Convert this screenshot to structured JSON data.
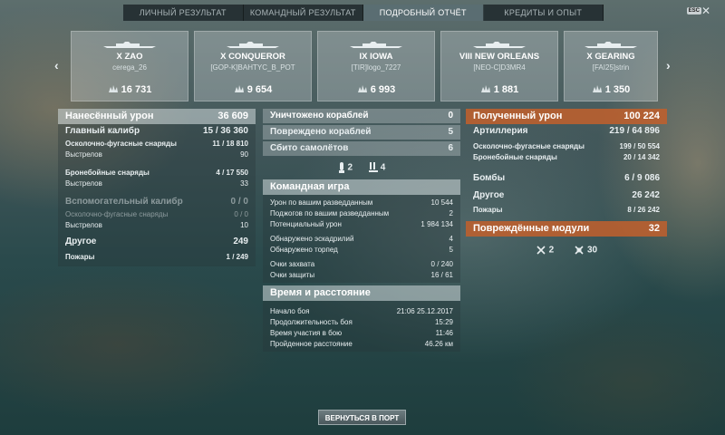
{
  "tabs": [
    "ЛИЧНЫЙ РЕЗУЛЬТАТ",
    "КОМАНДНЫЙ РЕЗУЛЬТАТ",
    "ПОДРОБНЫЙ ОТЧЁТ",
    "КРЕДИТЫ И ОПЫТ"
  ],
  "active_tab": 2,
  "esc_label": "ESC",
  "close_glyph": "✕",
  "nav": {
    "left": "‹",
    "right": "›"
  },
  "ships": [
    {
      "name": "X ZAO",
      "player": "cerega_26",
      "damage": "16 731"
    },
    {
      "name": "X CONQUEROR",
      "player": "[GOP-K]BAHTYC_B_POT",
      "damage": "9 654"
    },
    {
      "name": "IX IOWA",
      "player": "[TIR]logo_7227",
      "damage": "6 993"
    },
    {
      "name": "VIII NEW ORLEANS",
      "player": "[NEO-C]D3MR4",
      "damage": "1 881"
    },
    {
      "name": "X GEARING",
      "player": "[FAI25]strin",
      "damage": "1 350"
    }
  ],
  "left": {
    "header": {
      "label": "Нанесённый урон",
      "value": "36 609"
    },
    "main_caliber": {
      "label": "Главный калибр",
      "value": "15 / 36 360"
    },
    "he": {
      "label": "Осколочно-фугасные снаряды",
      "value": "11 / 18 810"
    },
    "he_shots": {
      "label": "Выстрелов",
      "value": "90"
    },
    "ap": {
      "label": "Бронебойные снаряды",
      "value": "4 / 17 550"
    },
    "ap_shots": {
      "label": "Выстрелов",
      "value": "33"
    },
    "secondary": {
      "label": "Вспомогательный калибр",
      "value": "0 / 0"
    },
    "sec_he": {
      "label": "Осколочно-фугасные снаряды",
      "value": "0 / 0"
    },
    "sec_shots": {
      "label": "Выстрелов",
      "value": "10"
    },
    "other": {
      "label": "Другое",
      "value": "249"
    },
    "fires": {
      "label": "Пожары",
      "value": "1 / 249"
    }
  },
  "middle": {
    "destroyed": {
      "label": "Уничтожено кораблей",
      "value": "0"
    },
    "damaged": {
      "label": "Повреждено кораблей",
      "value": "5"
    },
    "planes": {
      "label": "Сбито самолётов",
      "value": "6"
    },
    "icon_counts": {
      "torpedo_hits": "2",
      "flood": "4"
    },
    "team_header": "Командная игра",
    "team_rows": [
      {
        "label": "Урон по вашим разведданным",
        "value": "10 544"
      },
      {
        "label": "Поджогов по вашим разведданным",
        "value": "2"
      },
      {
        "label": "Потенциальный урон",
        "value": "1 984 134"
      },
      {
        "label": "Обнаружено эскадрилий",
        "value": "4"
      },
      {
        "label": "Обнаружено торпед",
        "value": "5"
      },
      {
        "label": "Очки захвата",
        "value": "0 / 240"
      },
      {
        "label": "Очки защиты",
        "value": "16 / 61"
      }
    ],
    "time_header": "Время и расстояние",
    "time_rows": [
      {
        "label": "Начало боя",
        "value": "21:06  25.12.2017"
      },
      {
        "label": "Продолжительность боя",
        "value": "15:29"
      },
      {
        "label": "Время участия в бою",
        "value": "11:46"
      },
      {
        "label": "Пройденное расстояние",
        "value": "46.26 км"
      }
    ]
  },
  "right": {
    "header": {
      "label": "Полученный урон",
      "value": "100 224"
    },
    "artillery": {
      "label": "Артиллерия",
      "value_a": "219 / ",
      "value_b": "64 896"
    },
    "he": {
      "label": "Осколочно-фугасные снаряды",
      "value_a": "199 / ",
      "value_b": "50 554"
    },
    "ap": {
      "label": "Бронебойные снаряды",
      "value_a": "20 / ",
      "value_b": "14 342"
    },
    "bombs": {
      "label": "Бомбы",
      "value": "6 / 9 086"
    },
    "other": {
      "label": "Другое",
      "value": "26 242"
    },
    "fires": {
      "label": "Пожары",
      "value_a": "8 / ",
      "value_b": "26 242"
    },
    "modules": {
      "label": "Повреждённые модули",
      "value": "32"
    },
    "module_icons": {
      "a": "2",
      "b": "30"
    }
  },
  "return_button": "ВЕРНУТЬСЯ В ПОРТ",
  "colors": {
    "orange": "#be602d",
    "panel": "#d2dadc"
  }
}
